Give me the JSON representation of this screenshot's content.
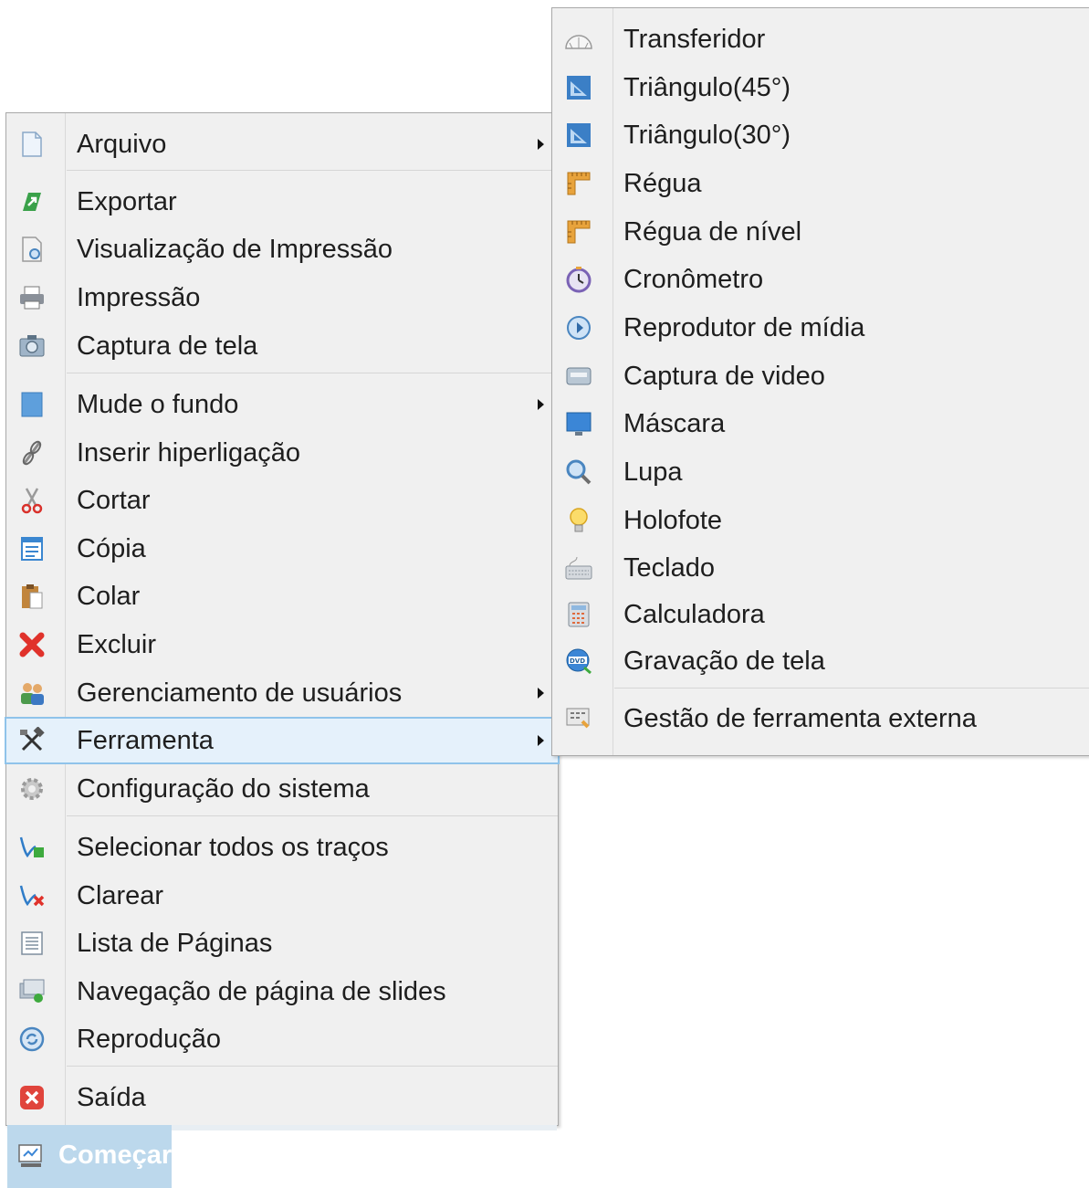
{
  "main_menu": {
    "items": [
      {
        "label": "Arquivo",
        "icon": "file-icon",
        "submenu": true
      },
      {
        "label": "Exportar",
        "icon": "export-icon"
      },
      {
        "label": "Visualização de Impressão",
        "icon": "print-preview-icon"
      },
      {
        "label": "Impressão",
        "icon": "printer-icon"
      },
      {
        "label": "Captura de tela",
        "icon": "screenshot-icon"
      },
      {
        "label": "Mude o fundo",
        "icon": "background-icon",
        "submenu": true
      },
      {
        "label": "Inserir hiperligação",
        "icon": "hyperlink-icon"
      },
      {
        "label": "Cortar",
        "icon": "scissors-icon"
      },
      {
        "label": "Cópia",
        "icon": "copy-icon"
      },
      {
        "label": "Colar",
        "icon": "paste-icon"
      },
      {
        "label": "Excluir",
        "icon": "delete-icon"
      },
      {
        "label": "Gerenciamento de usuários",
        "icon": "users-icon",
        "submenu": true
      },
      {
        "label": "Ferramenta",
        "icon": "tools-icon",
        "submenu": true,
        "highlighted": true
      },
      {
        "label": "Configuração do sistema",
        "icon": "gear-icon"
      },
      {
        "label": "Selecionar todos os traços",
        "icon": "select-strokes-icon"
      },
      {
        "label": "Clarear",
        "icon": "clear-icon"
      },
      {
        "label": "Lista de Páginas",
        "icon": "page-list-icon"
      },
      {
        "label": "Navegação de página de slides",
        "icon": "slide-navigation-icon"
      },
      {
        "label": "Reprodução",
        "icon": "replay-icon"
      },
      {
        "label": "Saída",
        "icon": "exit-icon"
      }
    ]
  },
  "tool_submenu": {
    "items": [
      {
        "label": "Transferidor",
        "icon": "protractor-icon"
      },
      {
        "label": "Triângulo(45°)",
        "icon": "triangle-45-icon"
      },
      {
        "label": "Triângulo(30°)",
        "icon": "triangle-30-icon"
      },
      {
        "label": "Régua",
        "icon": "ruler-icon"
      },
      {
        "label": "Régua de nível",
        "icon": "level-ruler-icon"
      },
      {
        "label": "Cronômetro",
        "icon": "stopwatch-icon"
      },
      {
        "label": "Reprodutor de mídia",
        "icon": "media-player-icon"
      },
      {
        "label": "Captura de video",
        "icon": "video-capture-icon"
      },
      {
        "label": "Máscara",
        "icon": "mask-icon"
      },
      {
        "label": "Lupa",
        "icon": "magnifier-icon"
      },
      {
        "label": "Holofote",
        "icon": "spotlight-icon"
      },
      {
        "label": "Teclado",
        "icon": "keyboard-icon"
      },
      {
        "label": "Calculadora",
        "icon": "calculator-icon"
      },
      {
        "label": "Gravação de tela",
        "icon": "screen-recording-icon"
      },
      {
        "label": "Gestão de ferramenta externa",
        "icon": "external-tool-icon"
      }
    ]
  },
  "start_button": {
    "label": "Começar",
    "icon": "start-icon"
  },
  "colors": {
    "menu_bg": "#f0f0f0",
    "highlight_bg": "#e5f1fb",
    "highlight_border": "#8fc3ea",
    "start_bg": "#bcd8ec"
  }
}
